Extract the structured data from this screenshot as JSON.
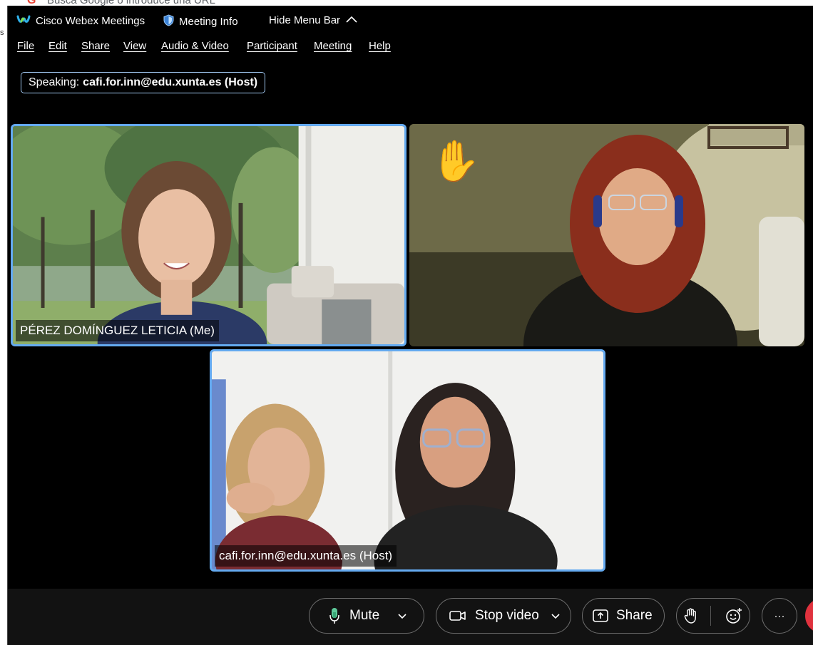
{
  "browser": {
    "address_hint": "Busca Google o introduce una URL"
  },
  "titlebar": {
    "app_name": "Cisco Webex Meetings",
    "meeting_info": "Meeting Info",
    "hide_menu_bar": "Hide Menu Bar"
  },
  "menu": [
    "File",
    "Edit",
    "Share",
    "View",
    "Audio & Video",
    "Participant",
    "Meeting",
    "Help"
  ],
  "speaking": {
    "label": "Speaking:",
    "name": "cafi.for.inn@edu.xunta.es (Host)"
  },
  "videos": [
    {
      "name": "PÉREZ DOMÍNGUEZ LETICIA (Me)",
      "active": true
    },
    {
      "name": "",
      "raised_hand": true,
      "hand_icon": "✋"
    },
    {
      "name": "cafi.for.inn@edu.xunta.es (Host)",
      "active": true
    }
  ],
  "controls": {
    "mute": "Mute",
    "stop_video": "Stop video",
    "share": "Share",
    "more": "···"
  },
  "colors": {
    "accent_border": "#64aaf0",
    "leave_red": "#e0323e",
    "hand": "#f5a623"
  }
}
